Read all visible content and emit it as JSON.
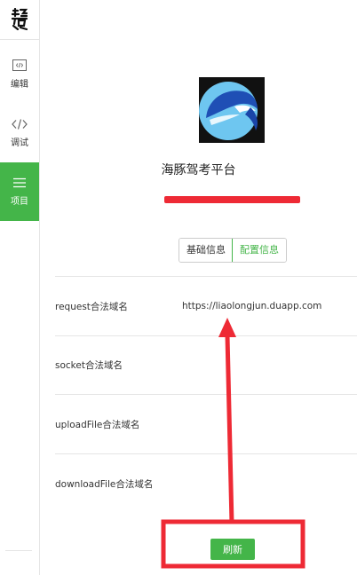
{
  "sidebar": {
    "items": [
      {
        "label": "编辑",
        "icon": "edit-icon"
      },
      {
        "label": "调试",
        "icon": "code-icon"
      },
      {
        "label": "项目",
        "icon": "menu-icon",
        "active": true
      }
    ]
  },
  "app": {
    "name": "海豚驾考平台"
  },
  "tabs": [
    {
      "label": "基础信息",
      "active": false
    },
    {
      "label": "配置信息",
      "active": true
    }
  ],
  "config_rows": [
    {
      "label": "request合法域名",
      "value": "https://liaolongjun.duapp.com"
    },
    {
      "label": "socket合法域名",
      "value": ""
    },
    {
      "label": "uploadFile合法域名",
      "value": ""
    },
    {
      "label": "downloadFile合法域名",
      "value": ""
    }
  ],
  "refresh_button": {
    "label": "刷新"
  },
  "colors": {
    "accent": "#44b549",
    "annotation": "#ee2a35"
  }
}
